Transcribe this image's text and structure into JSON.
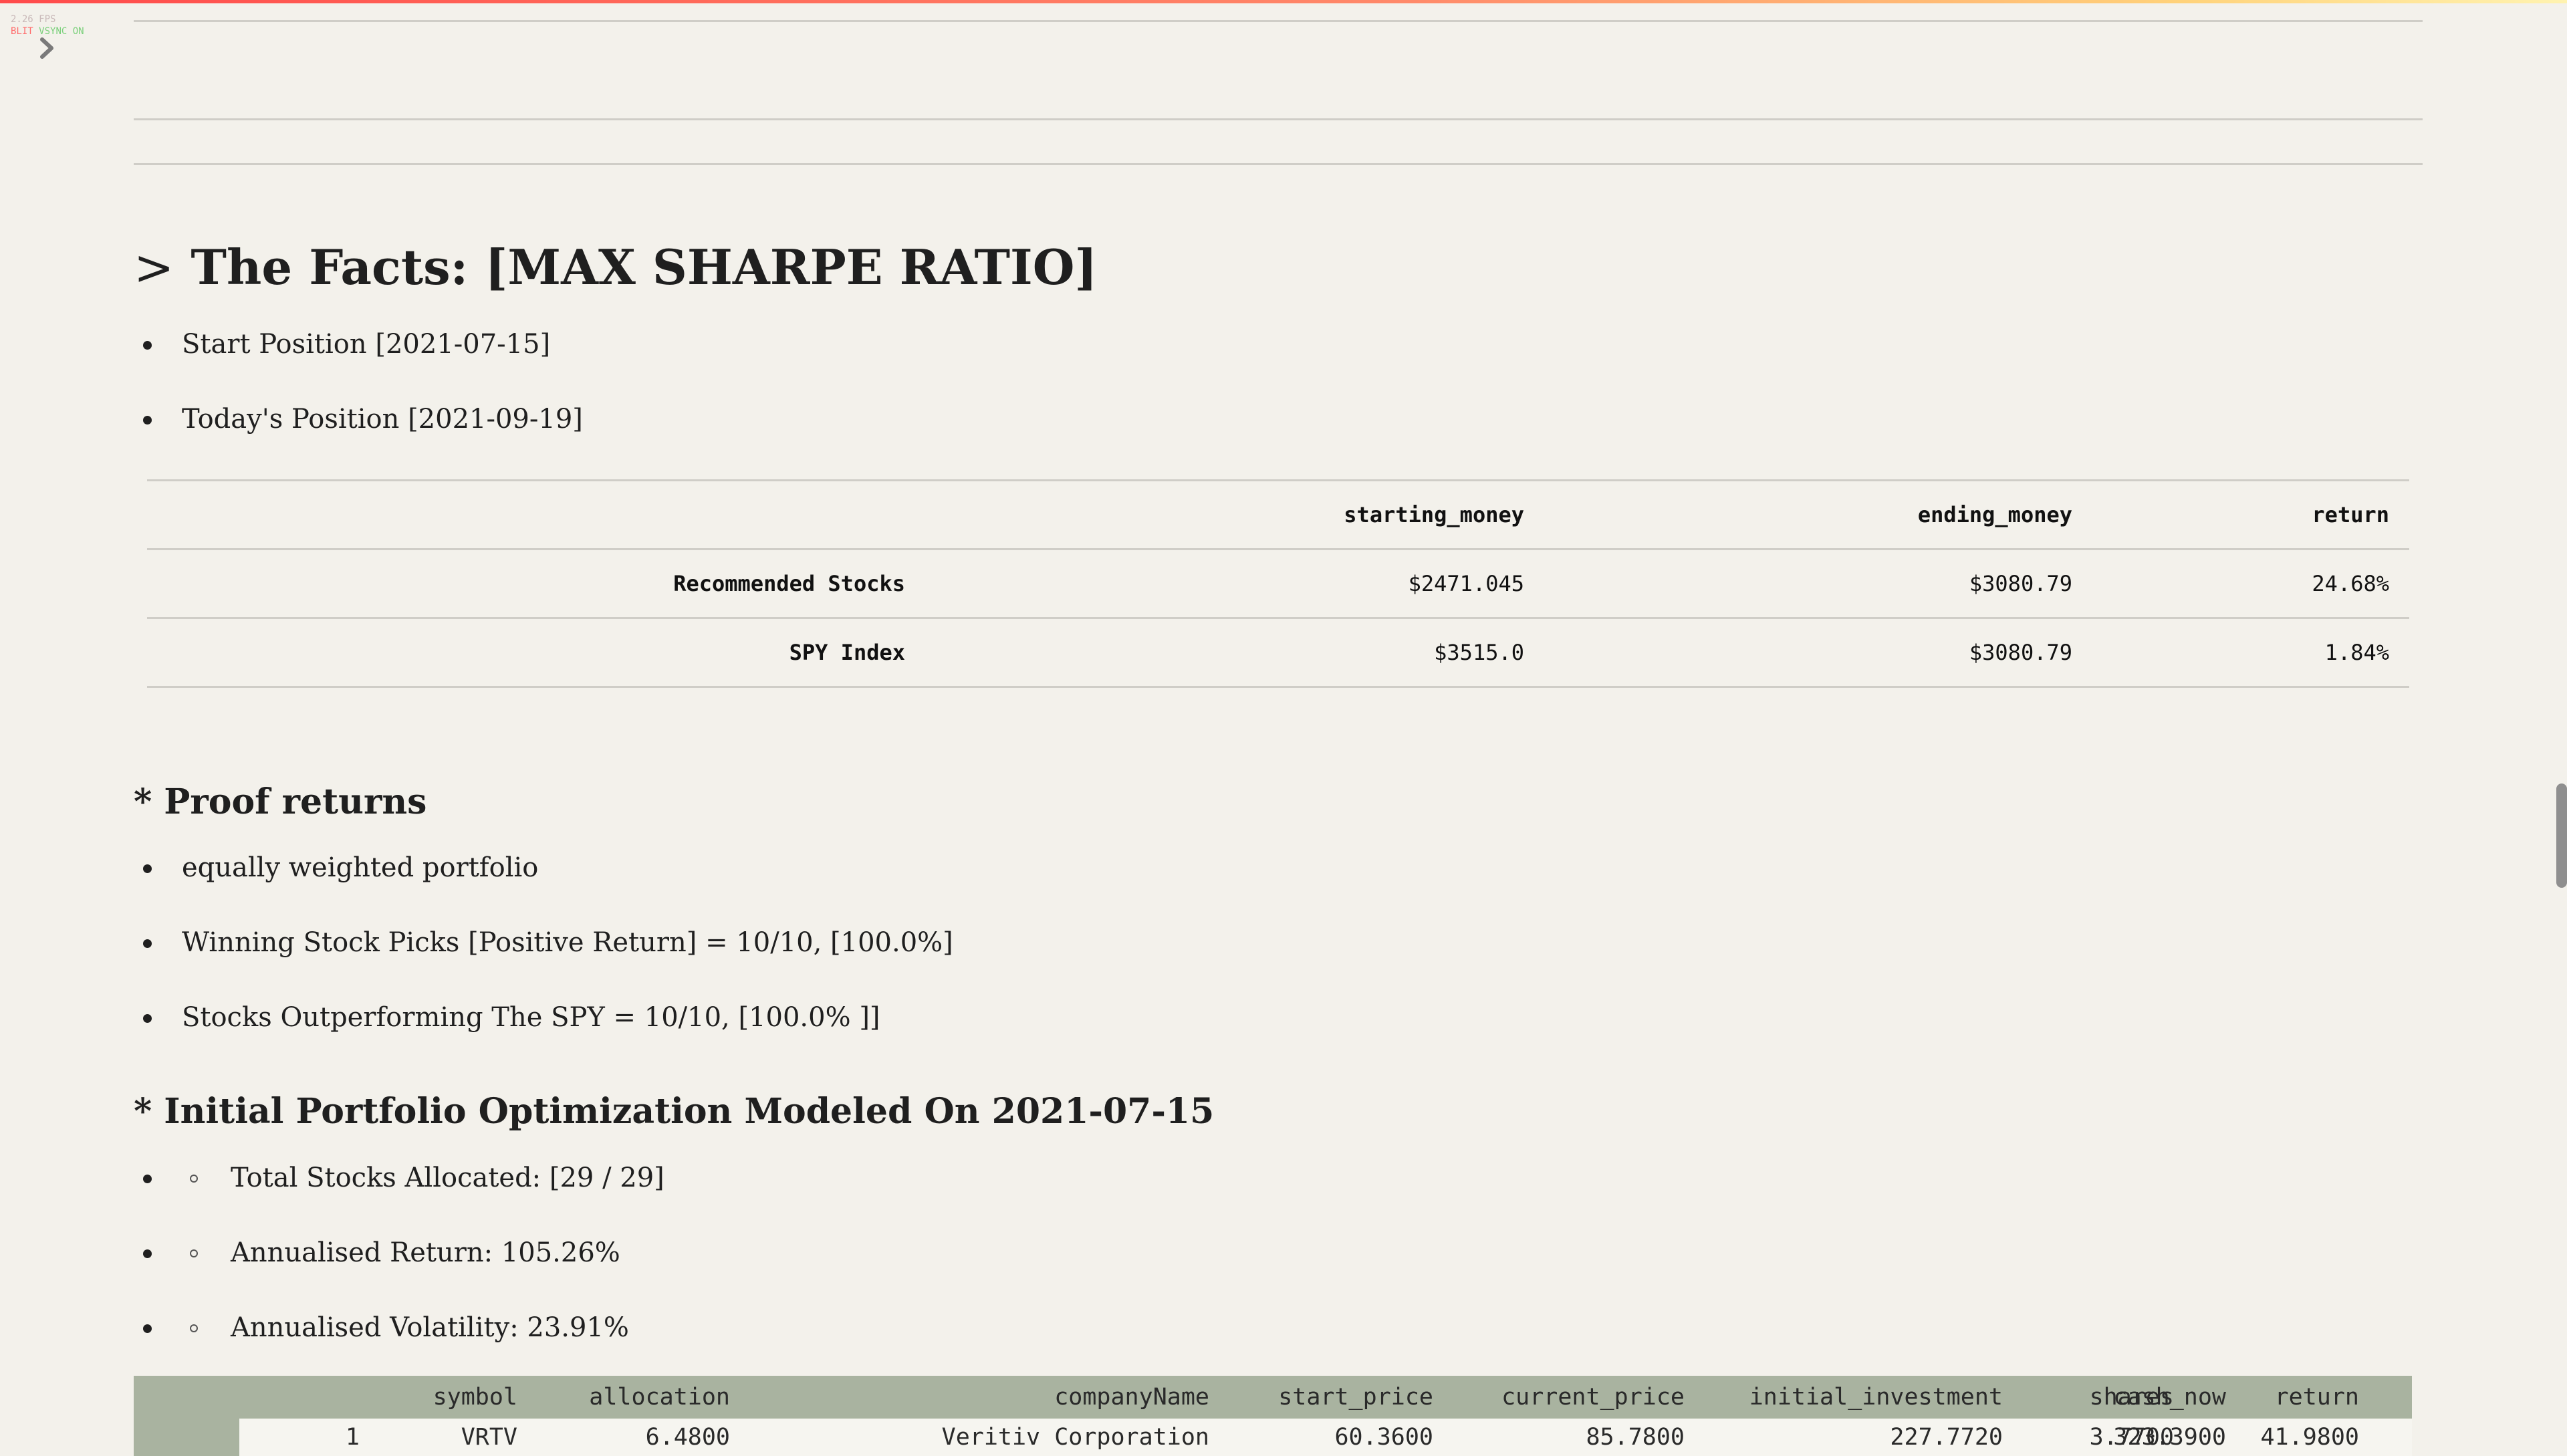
{
  "fps": {
    "line1": "2.26 FPS",
    "blit": "BLIT",
    "vsync": "VSYNC ON"
  },
  "colors": {
    "top_bar": [
      "#ff4b4b",
      "#ffd27a"
    ],
    "header_bg": "#a9b3a0",
    "background": "#f3f1eb"
  },
  "facts": {
    "prefix": ">",
    "title": "The Facts: [MAX SHARPE RATIO]",
    "bullets": [
      "Start Position [2021-07-15]",
      "Today's Position [2021-09-19]"
    ],
    "table": {
      "columns": [
        "starting_money",
        "ending_money",
        "return"
      ],
      "rows": [
        {
          "label": "Recommended Stocks",
          "starting_money": "$2471.045",
          "ending_money": "$3080.79",
          "return": "24.68%"
        },
        {
          "label": "SPY Index",
          "starting_money": "$3515.0",
          "ending_money": "$3080.79",
          "return": "1.84%"
        }
      ]
    }
  },
  "proof": {
    "title": "* Proof returns",
    "bullets": [
      "equally weighted portfolio",
      "Winning Stock Picks [Positive Return] = 10/10, [100.0%]",
      "Stocks Outperforming The SPY = 10/10, [100.0% ]]"
    ]
  },
  "optimization": {
    "title": "* Initial Portfolio Optimization Modeled On 2021-07-15",
    "bullets": [
      "Total Stocks Allocated: [29 / 29]",
      "Annualised Return: 105.26%",
      "Annualised Volatility: 23.91%"
    ]
  },
  "portfolio_table": {
    "columns": [
      "symbol",
      "allocation",
      "companyName",
      "start_price",
      "current_price",
      "initial_investment",
      "shares",
      "cash_now",
      "return"
    ],
    "rows": [
      {
        "index": "1",
        "symbol": "VRTV",
        "allocation": "6.4800",
        "companyName": "Veritiv Corporation",
        "start_price": "60.3600",
        "current_price": "85.7800",
        "initial_investment": "227.7720",
        "shares": "3.7700",
        "cash_now": "323.3900",
        "return": "41.9800"
      }
    ]
  }
}
